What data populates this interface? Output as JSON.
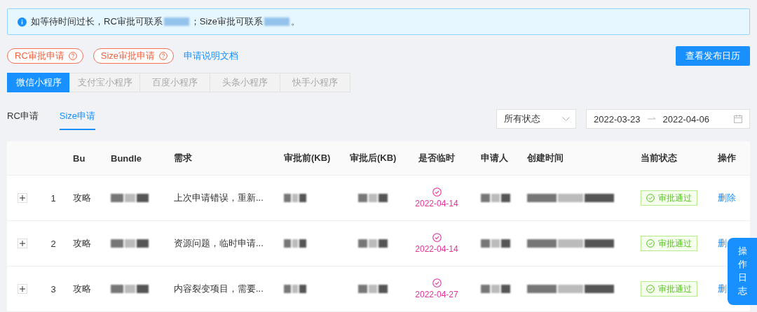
{
  "alert": {
    "parts": [
      "如等待时间过长，RC审批可联系",
      "；Size审批可联系",
      "。"
    ]
  },
  "apply_buttons": [
    {
      "label": "RC审批申请"
    },
    {
      "label": "Size审批申请"
    }
  ],
  "doc_link": "申请说明文档",
  "calendar_button": "查看发布日历",
  "platform_tabs": [
    {
      "label": "微信小程序",
      "selected": true
    },
    {
      "label": "支付宝小程序",
      "selected": false
    },
    {
      "label": "百度小程序",
      "selected": false
    },
    {
      "label": "头条小程序",
      "selected": false
    },
    {
      "label": "快手小程序",
      "selected": false
    }
  ],
  "type_tabs": [
    {
      "label": "RC申请",
      "selected": false
    },
    {
      "label": "Size申请",
      "selected": true
    }
  ],
  "status_select": {
    "value": "所有状态"
  },
  "date_range": {
    "start": "2022-03-23",
    "end": "2022-04-06"
  },
  "table": {
    "columns": [
      "Bu",
      "Bundle",
      "需求",
      "审批前(KB)",
      "审批后(KB)",
      "是否临时",
      "申请人",
      "创建时间",
      "当前状态",
      "操作"
    ],
    "rows": [
      {
        "index": "1",
        "bu": "攻略",
        "demand": "上次申请错误，重新...",
        "temporary": true,
        "temp_date": "2022-04-14",
        "status": "审批通过",
        "action": "删除"
      },
      {
        "index": "2",
        "bu": "攻略",
        "demand": "资源问题，临时申请...",
        "temporary": true,
        "temp_date": "2022-04-14",
        "status": "审批通过",
        "action": "删"
      },
      {
        "index": "3",
        "bu": "攻略",
        "demand": "内容裂变项目，需要...",
        "temporary": true,
        "temp_date": "2022-04-27",
        "status": "审批通过",
        "action": "删"
      }
    ]
  },
  "log_button": "操作日志"
}
